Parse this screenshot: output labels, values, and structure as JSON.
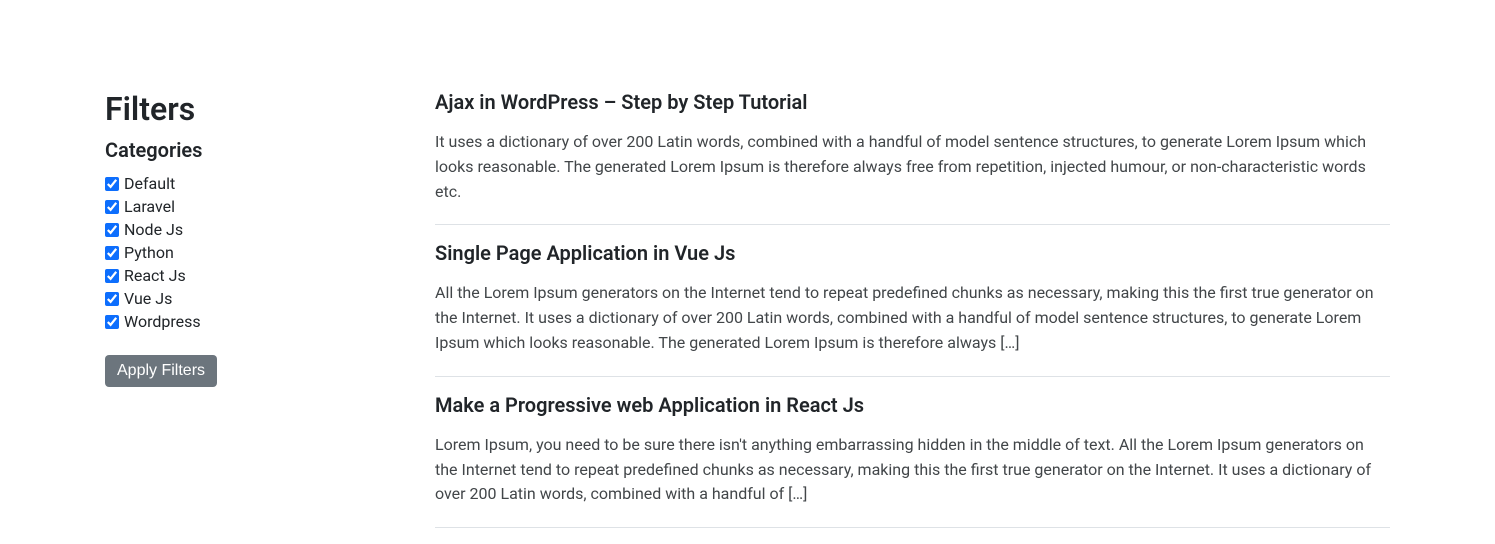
{
  "sidebar": {
    "filters_title": "Filters",
    "categories_title": "Categories",
    "categories": [
      {
        "label": "Default",
        "checked": true
      },
      {
        "label": "Laravel",
        "checked": true
      },
      {
        "label": "Node Js",
        "checked": true
      },
      {
        "label": "Python",
        "checked": true
      },
      {
        "label": "React Js",
        "checked": true
      },
      {
        "label": "Vue Js",
        "checked": true
      },
      {
        "label": "Wordpress",
        "checked": true
      }
    ],
    "apply_label": "Apply Filters"
  },
  "posts": [
    {
      "title": "Ajax in WordPress – Step by Step Tutorial",
      "excerpt": "It uses a dictionary of over 200 Latin words, combined with a handful of model sentence structures, to generate Lorem Ipsum which looks reasonable. The generated Lorem Ipsum is therefore always free from repetition, injected humour, or non-characteristic words etc."
    },
    {
      "title": "Single Page Application in Vue Js",
      "excerpt": "All the Lorem Ipsum generators on the Internet tend to repeat predefined chunks as necessary, making this the first true generator on the Internet. It uses a dictionary of over 200 Latin words, combined with a handful of model sentence structures, to generate Lorem Ipsum which looks reasonable. The generated Lorem Ipsum is therefore always […]"
    },
    {
      "title": "Make a Progressive web Application in React Js",
      "excerpt": "Lorem Ipsum, you need to be sure there isn't anything embarrassing hidden in the middle of text. All the Lorem Ipsum generators on the Internet tend to repeat predefined chunks as necessary, making this the first true generator on the Internet. It uses a dictionary of over 200 Latin words, combined with a handful of […]"
    }
  ]
}
